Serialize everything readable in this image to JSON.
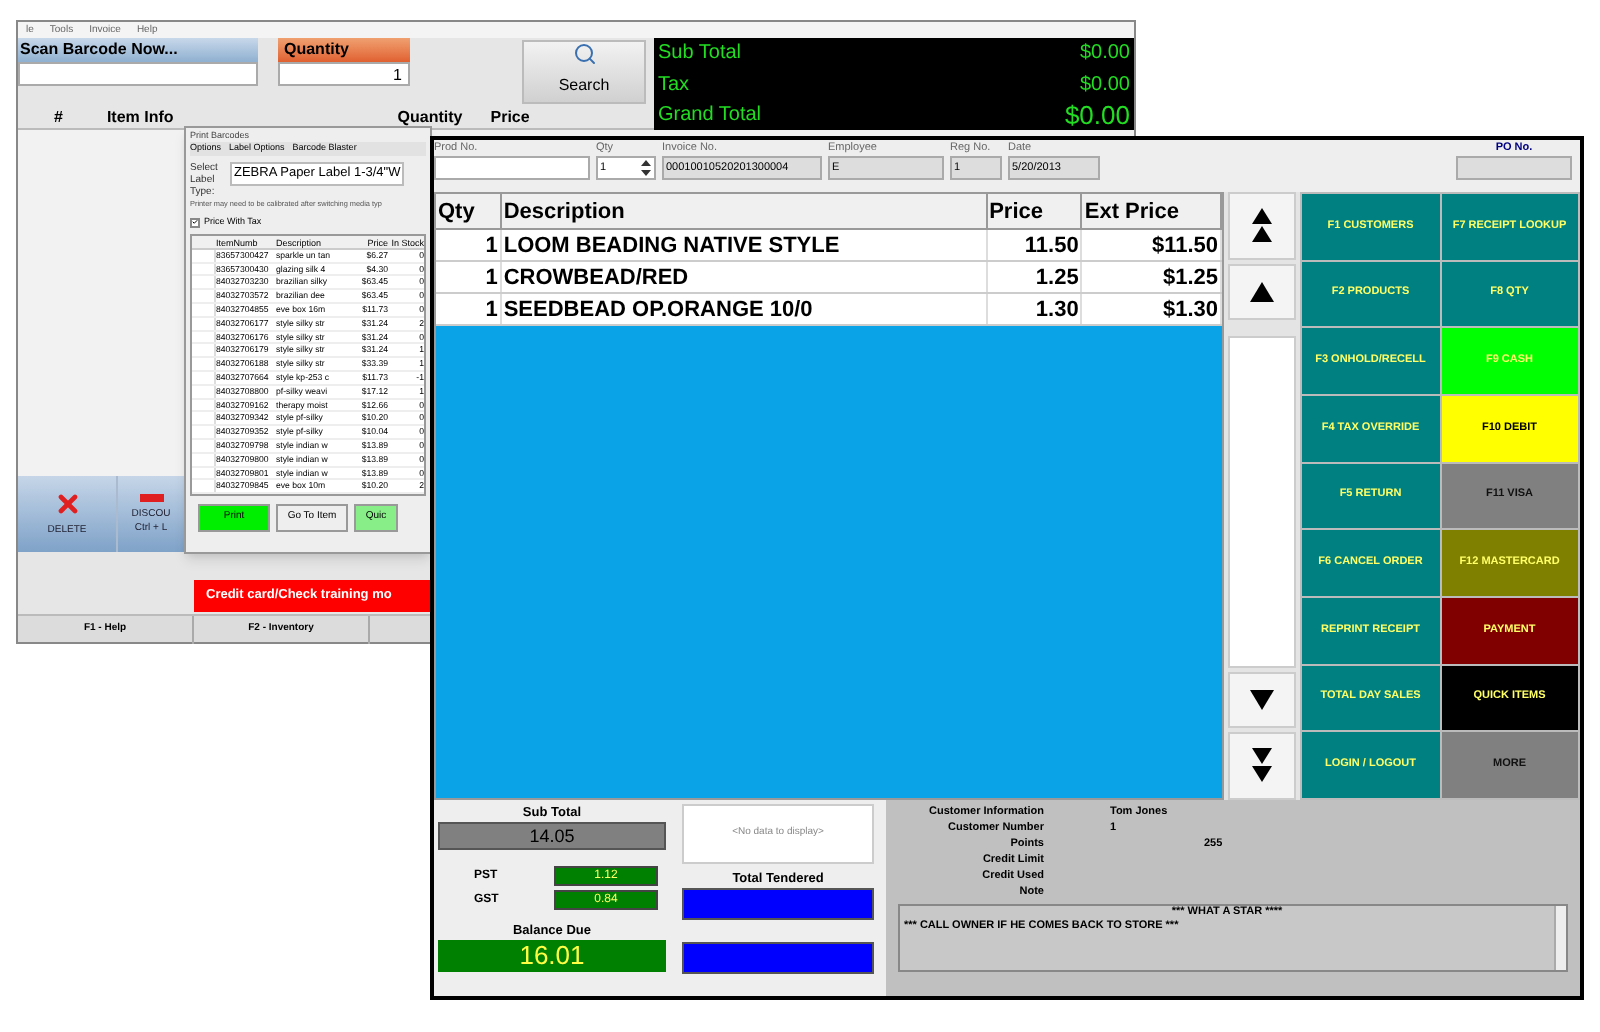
{
  "back_window": {
    "menu": [
      "le",
      "Tools",
      "Invoice",
      "Help"
    ],
    "scan_field": {
      "label": "Scan Barcode Now..."
    },
    "quantity_field": {
      "label": "Quantity",
      "value": "1"
    },
    "search_button": {
      "label": "Search"
    },
    "totals": [
      {
        "label": "Sub Total",
        "value": "$0.00"
      },
      {
        "label": "Tax",
        "value": "$0.00"
      },
      {
        "label": "Grand Total",
        "value": "$0.00"
      }
    ],
    "table_columns": [
      "#",
      "Item Info",
      "Quantity",
      "Price"
    ],
    "buttons": [
      {
        "kind": "delete",
        "label": "DELETE"
      },
      {
        "kind": "discount",
        "label": "DISCOU",
        "sublabel": "Ctrl + L"
      }
    ],
    "banner": "Credit card/Check training mo",
    "function_keys": [
      "F1 - Help",
      "F2 - Inventory"
    ]
  },
  "dialog": {
    "title": "Print Barcodes",
    "menu": [
      "Options",
      "Label Options",
      "Barcode Blaster"
    ],
    "label_type": {
      "label": "Select Label Type:",
      "value": "ZEBRA Paper Label 1-3/4\"W"
    },
    "note": "Printer may need to be calibrated after switching media typ",
    "price_with_tax": {
      "label": "Price With Tax",
      "checked": true
    },
    "columns": [
      "ItemNumb",
      "Description",
      "Price",
      "In Stock"
    ],
    "rows": [
      [
        "83657300427",
        "sparkle un tan",
        "$6.27",
        "0"
      ],
      [
        "83657300430",
        "glazing silk 4",
        "$4.30",
        "0"
      ],
      [
        "84032703230",
        "brazilian silky",
        "$63.45",
        "0"
      ],
      [
        "84032703572",
        "brazilian dee",
        "$63.45",
        "0"
      ],
      [
        "84032704855",
        "eve box 16m",
        "$11.73",
        "0"
      ],
      [
        "84032706177",
        "style silky str",
        "$31.24",
        "2"
      ],
      [
        "84032706176",
        "style silky str",
        "$31.24",
        "0"
      ],
      [
        "84032706179",
        "style silky str",
        "$31.24",
        "1"
      ],
      [
        "84032706188",
        "style silky str",
        "$33.39",
        "1"
      ],
      [
        "84032707664",
        "style kp-253 c",
        "$11.73",
        "-1"
      ],
      [
        "84032708800",
        "pf-silky weavi",
        "$17.12",
        "1"
      ],
      [
        "84032709162",
        "therapy moist",
        "$12.66",
        "0"
      ],
      [
        "84032709342",
        "style pf-silky",
        "$10.20",
        "0"
      ],
      [
        "84032709352",
        "style pf-silky",
        "$10.04",
        "0"
      ],
      [
        "84032709798",
        "style indian w",
        "$13.89",
        "0"
      ],
      [
        "84032709800",
        "style indian w",
        "$13.89",
        "0"
      ],
      [
        "84032709801",
        "style indian w",
        "$13.89",
        "0"
      ],
      [
        "84032709845",
        "eve box 10m",
        "$10.20",
        "2"
      ]
    ],
    "buttons": [
      {
        "kind": "print",
        "label": "Print"
      },
      {
        "kind": "normal",
        "label": "Go To Item"
      },
      {
        "kind": "quick",
        "label": "Quic"
      }
    ]
  },
  "front_window": {
    "fields": [
      {
        "kind": "text",
        "label": "Prod No."
      },
      {
        "kind": "spinner",
        "label": "Qty",
        "value": "1"
      },
      {
        "kind": "readonly",
        "label": "Invoice No.",
        "value": "00010010520201300004"
      },
      {
        "kind": "readonly",
        "label": "Employee",
        "value": "E"
      },
      {
        "kind": "readonly",
        "label": "Reg No.",
        "value": "1"
      },
      {
        "kind": "readonly",
        "label": "Date",
        "value": "5/20/2013"
      },
      {
        "kind": "po",
        "label": "PO No."
      }
    ],
    "order_columns": [
      "Qty",
      "Description",
      "Price",
      "Ext Price"
    ],
    "order_rows": [
      [
        "1",
        "LOOM BEADING NATIVE STYLE",
        "11.50",
        "$11.50"
      ],
      [
        "1",
        "CROWBEAD/RED",
        "1.25",
        "$1.25"
      ],
      [
        "1",
        "SEEDBEAD OP.ORANGE 10/0",
        "1.30",
        "$1.30"
      ]
    ],
    "function_buttons": [
      {
        "label": "F1 CUSTOMERS",
        "color": "#008080"
      },
      {
        "label": "F7 RECEIPT LOOKUP",
        "color": "#008080"
      },
      {
        "label": "F2 PRODUCTS",
        "color": "#008080"
      },
      {
        "label": "F8 QTY",
        "color": "#008080"
      },
      {
        "label": "F3 ONHOLD/RECELL",
        "color": "#008080"
      },
      {
        "label": "F9 CASH",
        "color": "#00ff00"
      },
      {
        "label": "F4 TAX OVERRIDE",
        "color": "#008080"
      },
      {
        "label": "F10 DEBIT",
        "color": "#ffff00"
      },
      {
        "label": "F5 RETURN",
        "color": "#008080"
      },
      {
        "label": "F11 VISA",
        "color": "#808080"
      },
      {
        "label": "F6 CANCEL ORDER",
        "color": "#008080"
      },
      {
        "label": "F12 MASTERCARD",
        "color": "#808000"
      },
      {
        "label": "REPRINT RECEIPT",
        "color": "#008080"
      },
      {
        "label": "PAYMENT",
        "color": "#800000"
      },
      {
        "label": "TOTAL DAY SALES",
        "color": "#008080"
      },
      {
        "label": "QUICK ITEMS",
        "color": "#000000"
      },
      {
        "label": "LOGIN / LOGOUT",
        "color": "#008080"
      },
      {
        "label": "MORE",
        "color": "#808080"
      }
    ],
    "sub_total": {
      "label": "Sub Total",
      "value": "14.05"
    },
    "taxes": [
      {
        "label": "PST",
        "value": "1.12"
      },
      {
        "label": "GST",
        "value": "0.84"
      }
    ],
    "balance_due": {
      "label": "Balance Due",
      "value": "16.01"
    },
    "no_data": "<No data to display>",
    "total_tendered": {
      "label": "Total Tendered"
    },
    "customer": [
      {
        "label": "Customer Information",
        "value": "Tom Jones"
      },
      {
        "label": "Customer Number",
        "value": "1"
      },
      {
        "label": "Points",
        "value": "255"
      },
      {
        "label": "Credit Limit"
      },
      {
        "label": "Credit Used"
      },
      {
        "label": "Note"
      }
    ],
    "note_lines": [
      "*** WHAT A STAR ****",
      "*** CALL OWNER IF HE COMES BACK TO STORE ***"
    ]
  }
}
